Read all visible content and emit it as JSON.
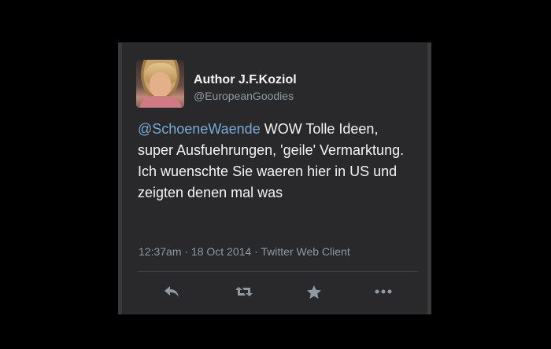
{
  "tweet": {
    "author_name": "Author J.F.Koziol",
    "author_handle": "@EuropeanGoodies",
    "mention": "@SchoeneWaende",
    "text": " WOW Tolle Ideen, super Ausfuehrungen, 'geile' Vermarktung. Ich wuenschte Sie waeren hier in US und zeigten denen mal was",
    "meta": "12:37am · 18 Oct 2014 · Twitter Web Client"
  },
  "actions": {
    "icons": [
      "reply-icon",
      "retweet-icon",
      "favorite-star-icon",
      "more-icon"
    ]
  },
  "colors": {
    "background": "#000000",
    "card": "#29292b",
    "text": "#f4f4f4",
    "mention": "#79a9d8",
    "muted": "#8f9aa4"
  }
}
